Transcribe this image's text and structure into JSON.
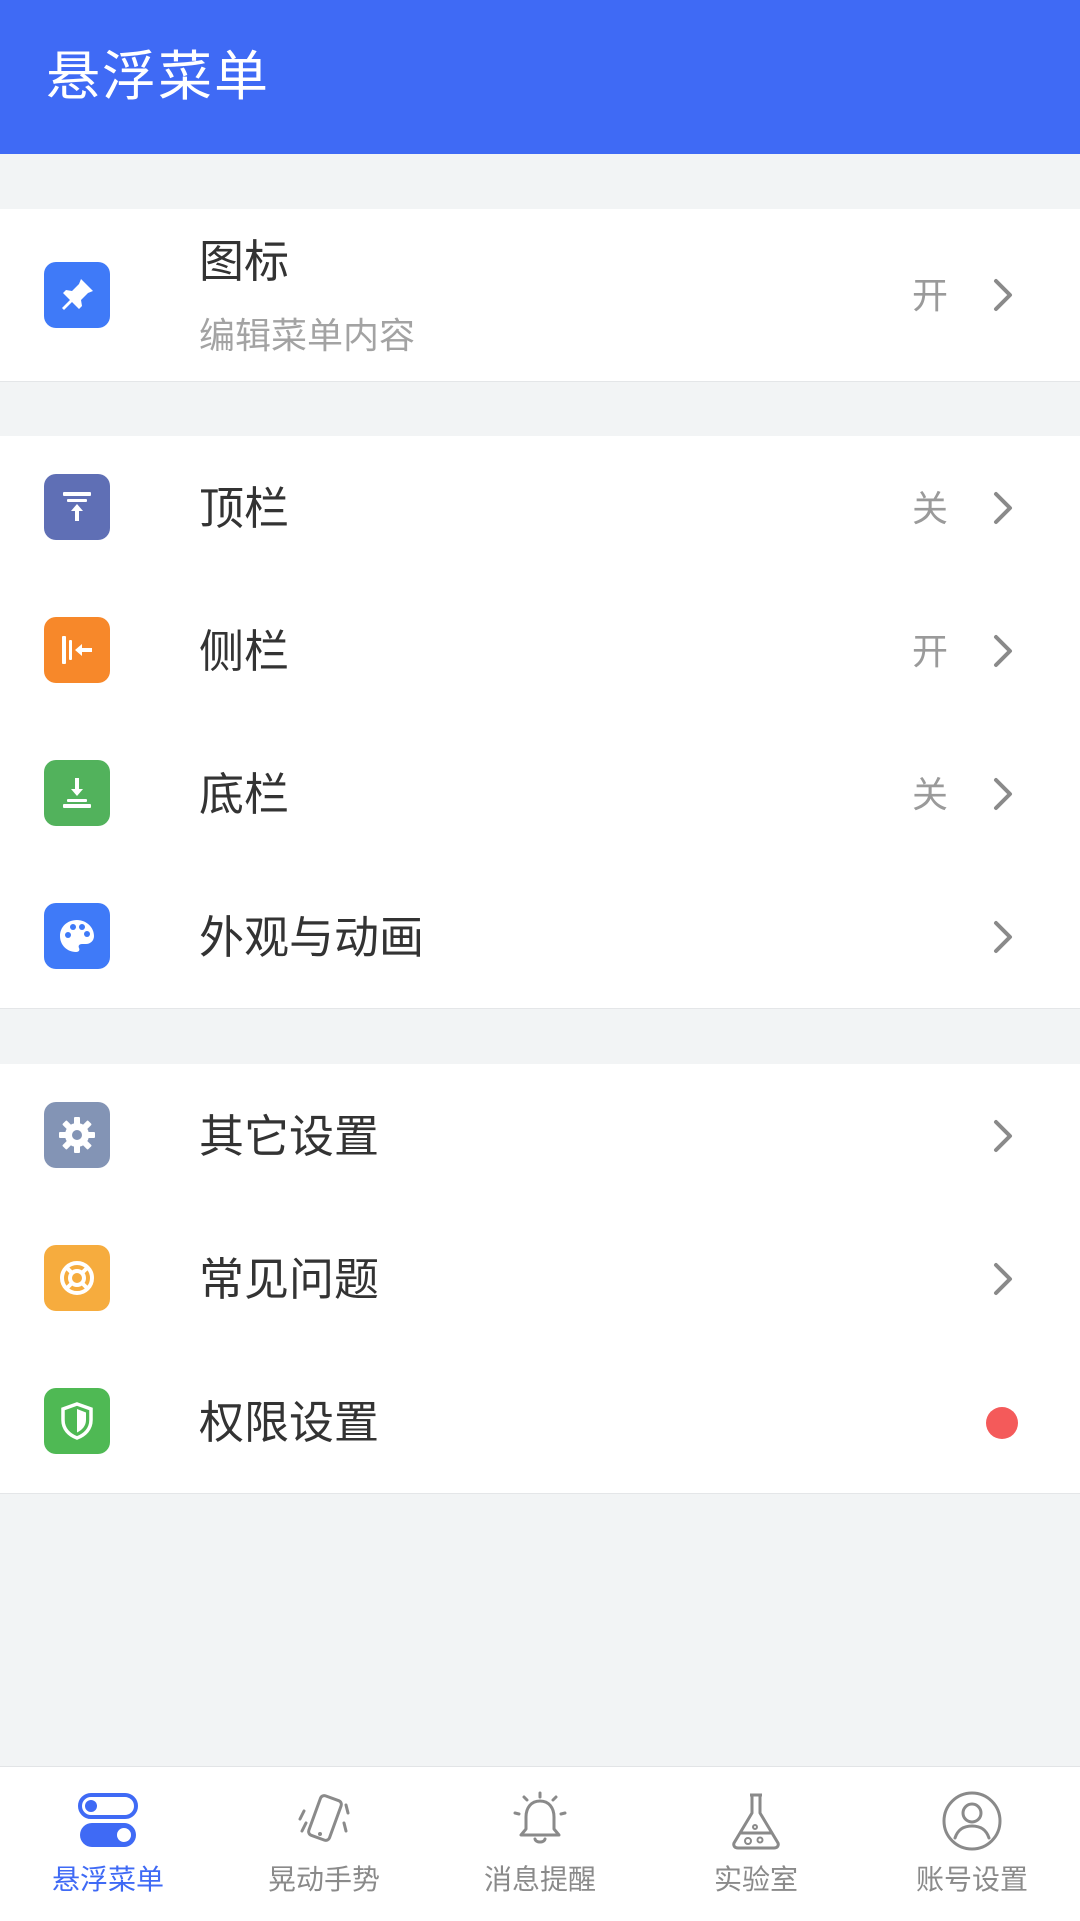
{
  "header": {
    "title": "悬浮菜单"
  },
  "groups": [
    {
      "items": [
        {
          "label": "图标",
          "sublabel": "编辑菜单内容",
          "value": "开",
          "icon": "pin-icon",
          "color": "#3f7af8"
        }
      ]
    },
    {
      "items": [
        {
          "label": "顶栏",
          "value": "关",
          "icon": "top-bar-icon",
          "color": "#5f6fb5"
        },
        {
          "label": "侧栏",
          "value": "开",
          "icon": "side-bar-icon",
          "color": "#f7882a"
        },
        {
          "label": "底栏",
          "value": "关",
          "icon": "bottom-bar-icon",
          "color": "#52b25c"
        },
        {
          "label": "外观与动画",
          "value": "",
          "icon": "palette-icon",
          "color": "#3f7af8"
        }
      ]
    },
    {
      "items": [
        {
          "label": "其它设置",
          "icon": "gear-icon",
          "color": "#8394b5"
        },
        {
          "label": "常见问题",
          "icon": "lifebuoy-icon",
          "color": "#f6ac3e"
        },
        {
          "label": "权限设置",
          "icon": "shield-icon",
          "color": "#4fb954",
          "badge_color": "#f45a5a"
        }
      ]
    }
  ],
  "tabbar": {
    "tabs": [
      {
        "label": "悬浮菜单",
        "icon": "toggle-icon",
        "active": true
      },
      {
        "label": "晃动手势",
        "icon": "shake-phone-icon",
        "active": false
      },
      {
        "label": "消息提醒",
        "icon": "bell-icon",
        "active": false
      },
      {
        "label": "实验室",
        "icon": "flask-icon",
        "active": false
      },
      {
        "label": "账号设置",
        "icon": "user-circle-icon",
        "active": false
      }
    ],
    "active_color": "#3f6af5"
  }
}
